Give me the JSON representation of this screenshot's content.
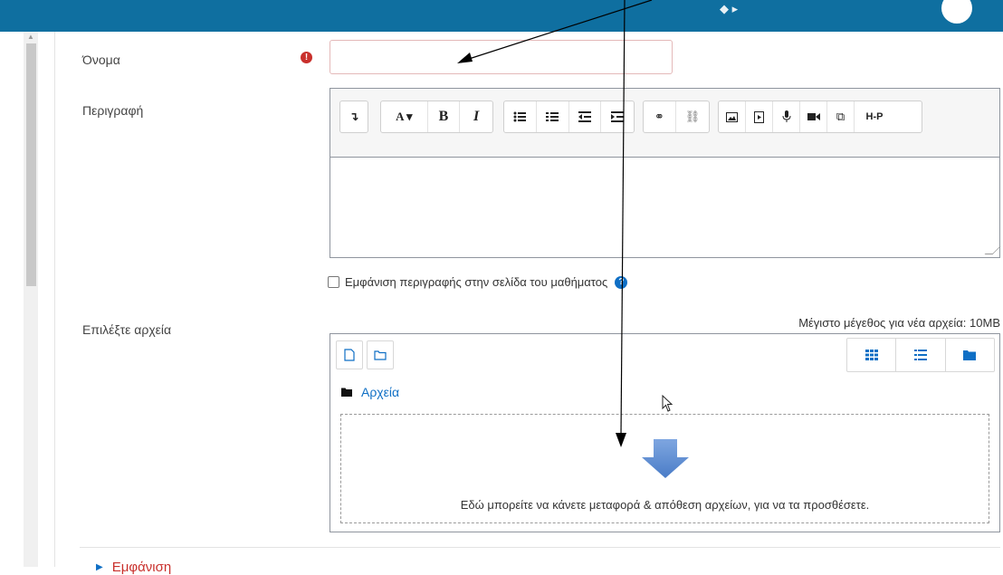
{
  "form": {
    "name_label": "Όνομα",
    "description_label": "Περιγραφή",
    "show_description_label": "Εμφάνιση περιγραφής στην σελίδα του μαθήματος",
    "select_files_label": "Επιλέξτε αρχεία",
    "max_size_text": "Μέγιστο μέγεθος για νέα αρχεία: 10MB",
    "folder_name": "Αρχεία",
    "drop_message": "Εδώ μπορείτε να κάνετε μεταφορά & απόθεση αρχείων, για να τα προσθέσετε.",
    "appearance_section": "Εμφάνιση"
  },
  "editor": {
    "font_button": "A ▾",
    "bold_button": "B",
    "italic_button": "I",
    "h5p_button": "H-P"
  },
  "colors": {
    "topbar": "#0f6fa0",
    "link": "#0f6fc5",
    "required": "#c9302c"
  }
}
